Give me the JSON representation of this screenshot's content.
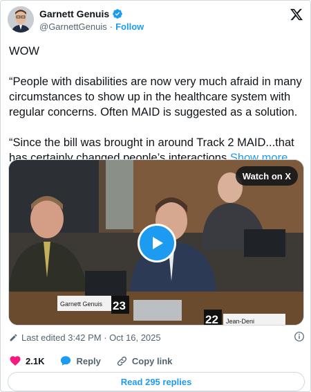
{
  "author": {
    "display_name": "Garnett Genuis",
    "handle": "@GarnettGenuis",
    "follow_label": "Follow",
    "verified_icon": "verified-badge-icon"
  },
  "brand_icon": "x-logo-icon",
  "tweet": {
    "paragraphs": [
      "WOW",
      "“People with disabilities are now very much afraid in many circumstances to show up in the healthcare system with regular concerns. Often MAID is suggested as a solution.",
      "“Since the bill was brought in around Track 2 MAID...that has certainly changed people’s interactions"
    ],
    "show_more": "Show more"
  },
  "media": {
    "watch_label": "Watch on X",
    "play_icon": "play-icon",
    "nameplate_left": "Garnett Genuis",
    "number_left": "23",
    "number_right": "22",
    "nameplate_right": "Jean-Deni"
  },
  "meta": {
    "edited_text": "Last edited 3:42 PM · Oct 16, 2025",
    "info_icon": "info-icon"
  },
  "actions": {
    "like_count": "2.1K",
    "reply_label": "Reply",
    "copy_link_label": "Copy link"
  },
  "replies_button": "Read 295 replies",
  "colors": {
    "accent": "#1d9bf0",
    "like": "#f91880",
    "text": "#0f1419",
    "muted": "#536471",
    "border": "#cfd9de"
  }
}
